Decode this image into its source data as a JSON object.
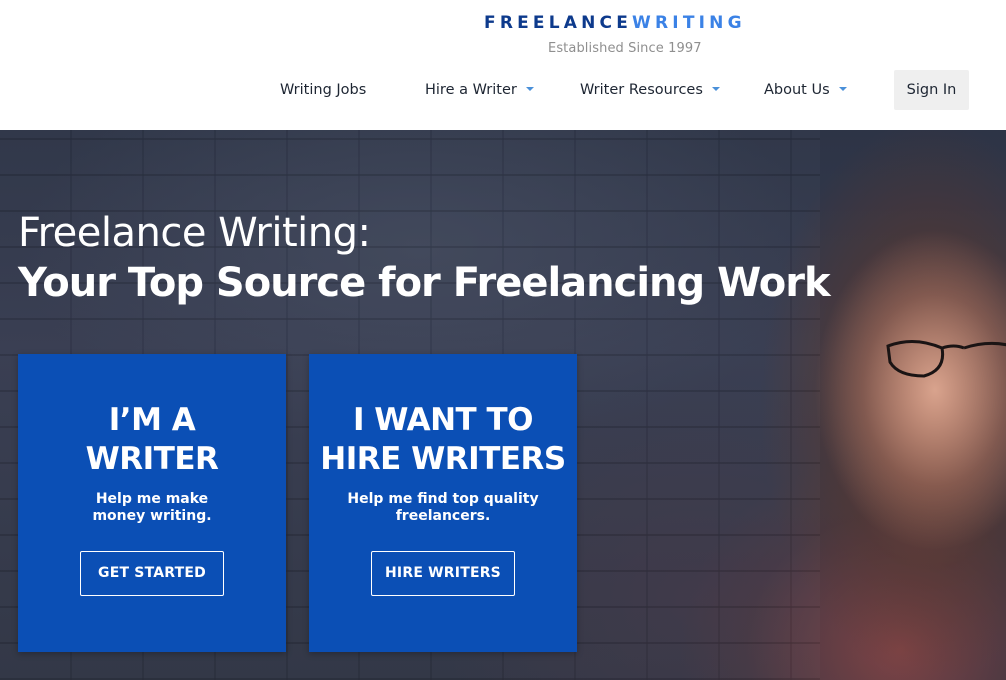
{
  "logo": {
    "word_a": "FREELANCE",
    "word_b": "WRITING",
    "tagline": "Established Since 1997",
    "color_a": "#0d3a8c",
    "color_b": "#3b82e6"
  },
  "nav": {
    "items": [
      {
        "label": "Writing Jobs",
        "has_dropdown": false
      },
      {
        "label": "Hire a Writer",
        "has_dropdown": true
      },
      {
        "label": "Writer Resources",
        "has_dropdown": true
      },
      {
        "label": "About Us",
        "has_dropdown": true
      }
    ],
    "sign_in": "Sign In",
    "dropdown_icon": "caret-down-icon"
  },
  "hero": {
    "line1": "Freelance Writing:",
    "line2": "Your Top Source for Freelancing Work"
  },
  "cards": {
    "writer": {
      "title": "I’M A\nWRITER",
      "subtitle": "Help me make\nmoney writing.",
      "button": "GET STARTED"
    },
    "hire": {
      "title": "I WANT TO\nHIRE WRITERS",
      "subtitle": "Help me find top quality\nfreelancers.",
      "button": "HIRE WRITERS"
    },
    "color": "#0b4fb5"
  }
}
